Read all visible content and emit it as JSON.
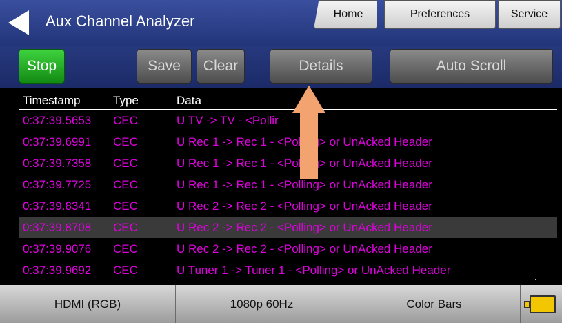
{
  "header": {
    "title": "Aux Channel Analyzer",
    "tabs": [
      {
        "label": "Home"
      },
      {
        "label": "Preferences"
      },
      {
        "label": "Service"
      }
    ]
  },
  "toolbar": {
    "stop_label": "Stop",
    "save_label": "Save",
    "clear_label": "Clear",
    "details_label": "Details",
    "autoscroll_label": "Auto Scroll"
  },
  "table": {
    "columns": [
      "Timestamp",
      "Type",
      "Data"
    ],
    "rows": [
      {
        "timestamp": "0:37:39.5653",
        "type": "CEC",
        "data": "U TV -> TV - <Pollir"
      },
      {
        "timestamp": "0:37:39.6991",
        "type": "CEC",
        "data": "U Rec 1 -> Rec 1 - <Polling> or UnAcked Header"
      },
      {
        "timestamp": "0:37:39.7358",
        "type": "CEC",
        "data": "U Rec 1 -> Rec 1 - <Polling> or UnAcked Header"
      },
      {
        "timestamp": "0:37:39.7725",
        "type": "CEC",
        "data": "U Rec 1 -> Rec 1 - <Polling> or UnAcked Header"
      },
      {
        "timestamp": "0:37:39.8341",
        "type": "CEC",
        "data": "U Rec 2 -> Rec 2 - <Polling> or UnAcked Header"
      },
      {
        "timestamp": "0:37:39.8708",
        "type": "CEC",
        "data": "U Rec 2 -> Rec 2 - <Polling> or UnAcked Header"
      },
      {
        "timestamp": "0:37:39.9076",
        "type": "CEC",
        "data": "U Rec 2 -> Rec 2 - <Polling> or UnAcked Header"
      },
      {
        "timestamp": "0:37:39.9692",
        "type": "CEC",
        "data": "U Tuner 1 -> Tuner 1 - <Polling> or UnAcked Header"
      }
    ],
    "selected_row": 5
  },
  "footer": {
    "video_interface": "HDMI (RGB)",
    "video_format": "1080p 60Hz",
    "image": "Color Bars"
  },
  "icons": {
    "back": "back-arrow-icon",
    "battery": "battery-icon",
    "annotation": "up-arrow-annotation"
  },
  "colors": {
    "header_blue": "#2a3d87",
    "row_text": "#e000e0",
    "stop_green": "#2bb52b",
    "annotation_orange": "#f3a36f"
  }
}
